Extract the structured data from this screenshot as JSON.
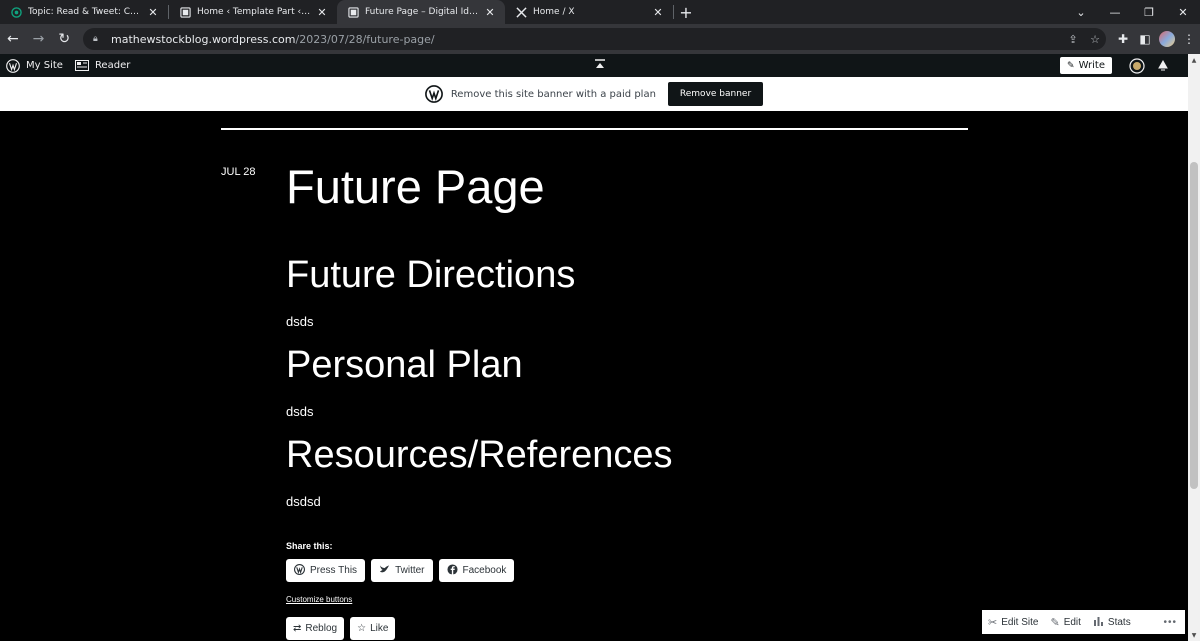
{
  "browser": {
    "tabs": [
      {
        "title": "Topic: Read & Tweet: Chapter 12",
        "icon": "openai-icon",
        "active": false
      },
      {
        "title": "Home ‹ Template Part ‹ Editor ‹ D",
        "icon": "page-icon",
        "active": false
      },
      {
        "title": "Future Page – Digital Identity Jou",
        "icon": "page-icon",
        "active": true
      },
      {
        "title": "Home / X",
        "icon": "x-logo-icon",
        "active": false
      }
    ],
    "new_tab": "+",
    "url_host": "mathewstockblog.wordpress.com",
    "url_path": "/2023/07/28/future-page/"
  },
  "adminbar": {
    "my_site": "My Site",
    "reader": "Reader",
    "write": "Write"
  },
  "banner": {
    "text": "Remove this site banner with a paid plan",
    "button": "Remove banner"
  },
  "post": {
    "date": "JUL 28",
    "title": "Future Page",
    "sections": [
      {
        "heading": "Future Directions",
        "body": "dsds"
      },
      {
        "heading": "Personal Plan",
        "body": "dsds"
      },
      {
        "heading": "Resources/References",
        "body": "dsdsd"
      }
    ]
  },
  "share": {
    "label": "Share this:",
    "buttons": [
      "Press This",
      "Twitter",
      "Facebook"
    ],
    "customize": "Customize buttons"
  },
  "like": {
    "reblog": "Reblog",
    "like": "Like"
  },
  "actionbar": {
    "edit_site": "Edit Site",
    "edit": "Edit",
    "stats": "Stats",
    "more": "•••"
  }
}
